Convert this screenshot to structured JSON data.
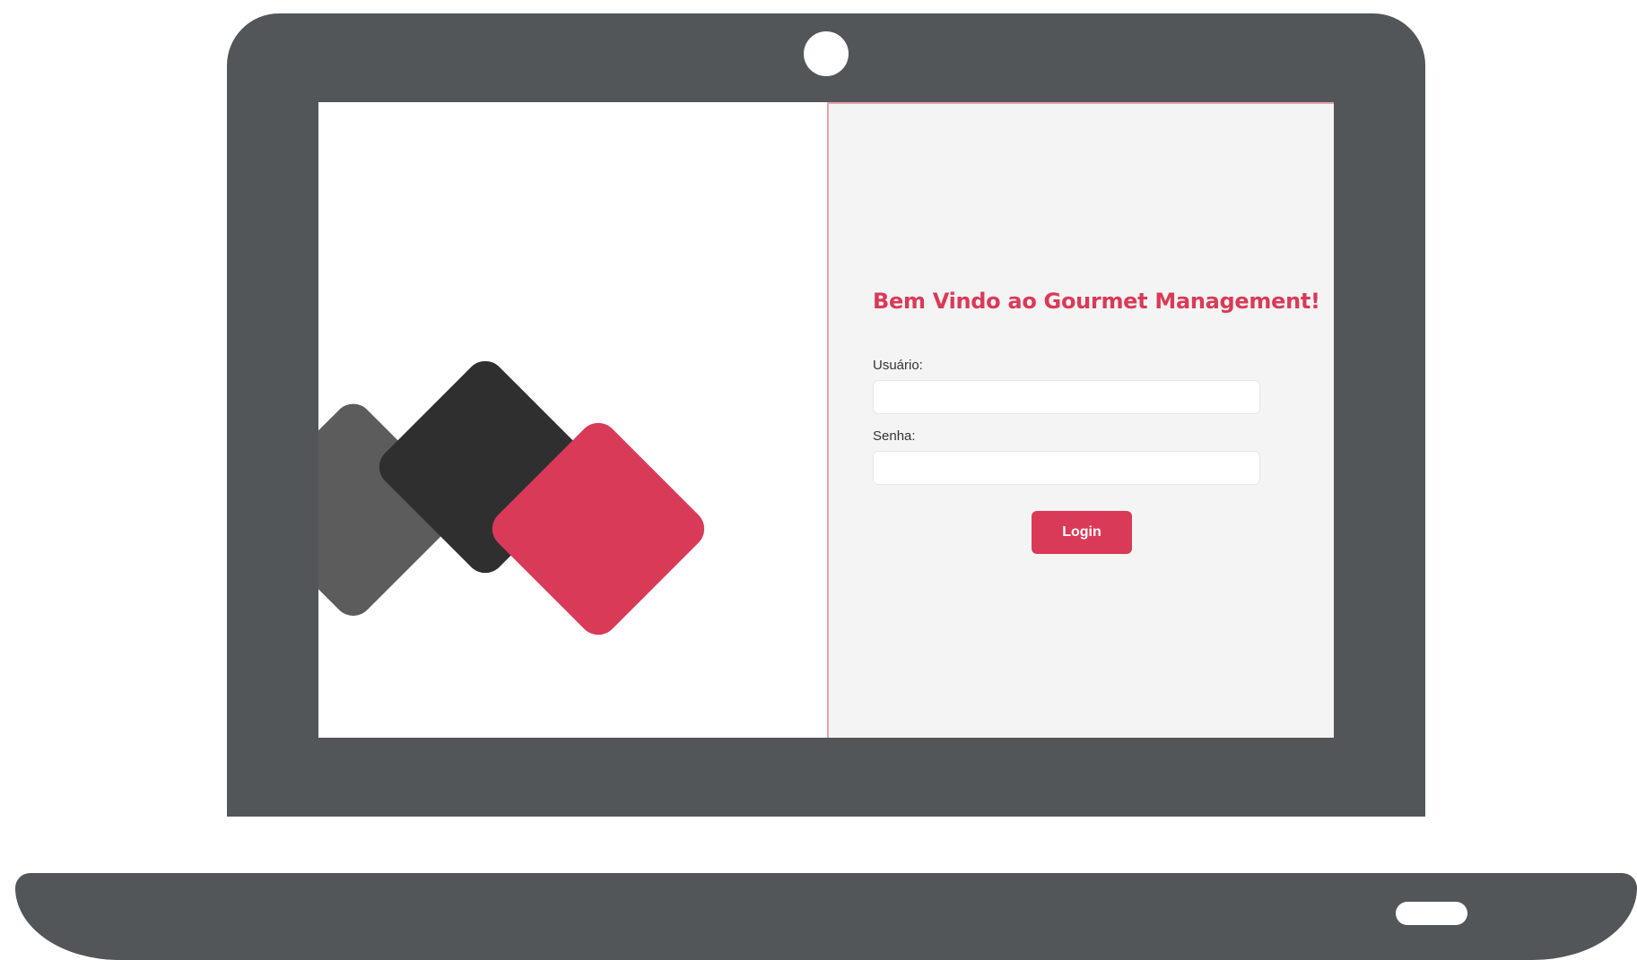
{
  "login": {
    "title": "Bem Vindo ao Gourmet Management!",
    "username_label": "Usuário:",
    "username_value": "",
    "password_label": "Senha:",
    "password_value": "",
    "submit_label": "Login"
  },
  "colors": {
    "accent": "#d93a58",
    "dark_tile": "#2f2f2f",
    "gray_tile": "#5c5c5c",
    "device_frame": "#525659",
    "panel_background": "#f4f4f4"
  },
  "icons": {
    "logo": "three-rounded-diamonds-logo",
    "webcam": "webcam-icon",
    "trackpad": "trackpad-slot"
  }
}
